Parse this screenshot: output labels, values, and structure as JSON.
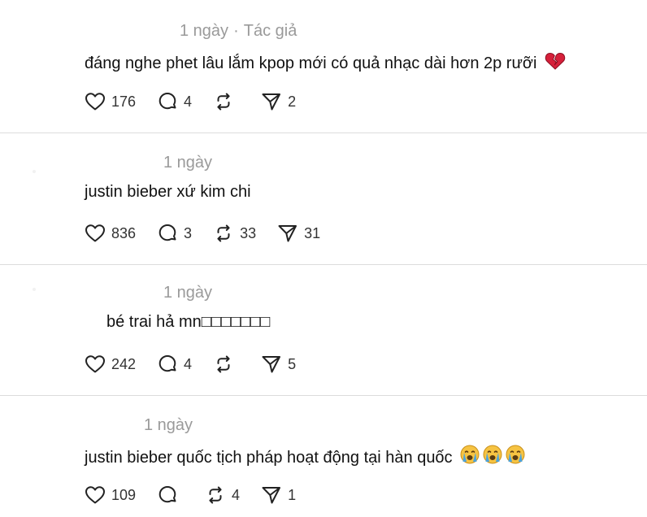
{
  "posts": [
    {
      "time": "1 ngày",
      "separator": "·",
      "author_badge": "Tác giả",
      "text": "đáng nghe phet lâu lắm kpop mới có quả nhạc dài hơn 2p rưỡi",
      "emoji": "broken-heart",
      "likes": "176",
      "replies": "4",
      "reposts": "",
      "shares": "2"
    },
    {
      "time": "1 ngày",
      "text": "justin bieber xứ kim chi",
      "likes": "836",
      "replies": "3",
      "reposts": "33",
      "shares": "31"
    },
    {
      "time": "1 ngày",
      "text": "bé trai hả mn",
      "text_tail": "□□□□□□□",
      "likes": "242",
      "replies": "4",
      "reposts": "",
      "shares": "5"
    },
    {
      "time": "1 ngày",
      "text": "justin bieber quốc tịch pháp hoạt động tại hàn quốc",
      "emoji": "crying-face x3",
      "likes": "109",
      "replies": "",
      "reposts": "4",
      "shares": "1"
    }
  ],
  "icons": {
    "like": "heart-icon",
    "reply": "speech-bubble-icon",
    "repost": "repost-icon",
    "share": "send-icon"
  },
  "colors": {
    "meta": "#9a9a9a",
    "text": "#111111",
    "icon": "#222222",
    "divider": "#dcdcdc",
    "broken_heart": "#d6203a",
    "crying_face": "#f6c342",
    "tears": "#4aa3df"
  }
}
